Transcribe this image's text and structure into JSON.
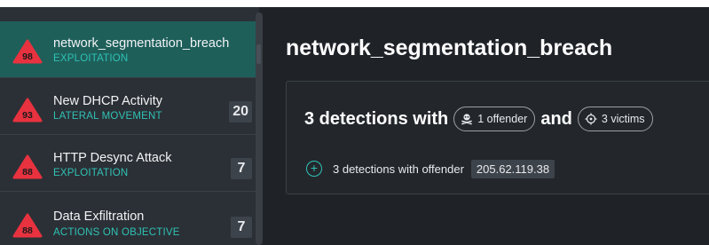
{
  "sidebar": {
    "items": [
      {
        "risk": "98",
        "title": "network_segmentation_breach",
        "category": "EXPLOITATION",
        "count": ""
      },
      {
        "risk": "93",
        "title": "New DHCP Activity",
        "category": "LATERAL MOVEMENT",
        "count": "20"
      },
      {
        "risk": "88",
        "title": "HTTP Desync Attack",
        "category": "EXPLOITATION",
        "count": "7"
      },
      {
        "risk": "88",
        "title": "Data Exfiltration",
        "category": "ACTIONS ON OBJECTIVE",
        "count": "7"
      }
    ]
  },
  "main": {
    "title": "network_segmentation_breach",
    "summary": {
      "prefix": "3 detections with",
      "offender_label": "1 offender",
      "conjunction": "and",
      "victims_label": "3 victims"
    },
    "row": {
      "expand_symbol": "+",
      "text": "3 detections with offender",
      "ip": "205.62.119.38"
    }
  },
  "colors": {
    "accent": "#2fc2b5",
    "selected": "#1e5f5a",
    "risk": "#e8323f",
    "background": "#1f2328",
    "sidebar": "#2b3036"
  },
  "icons": {
    "risk_badge": "triangle-risk-icon",
    "offender": "skull-icon",
    "victims": "target-icon",
    "expand": "plus-circle-icon"
  }
}
